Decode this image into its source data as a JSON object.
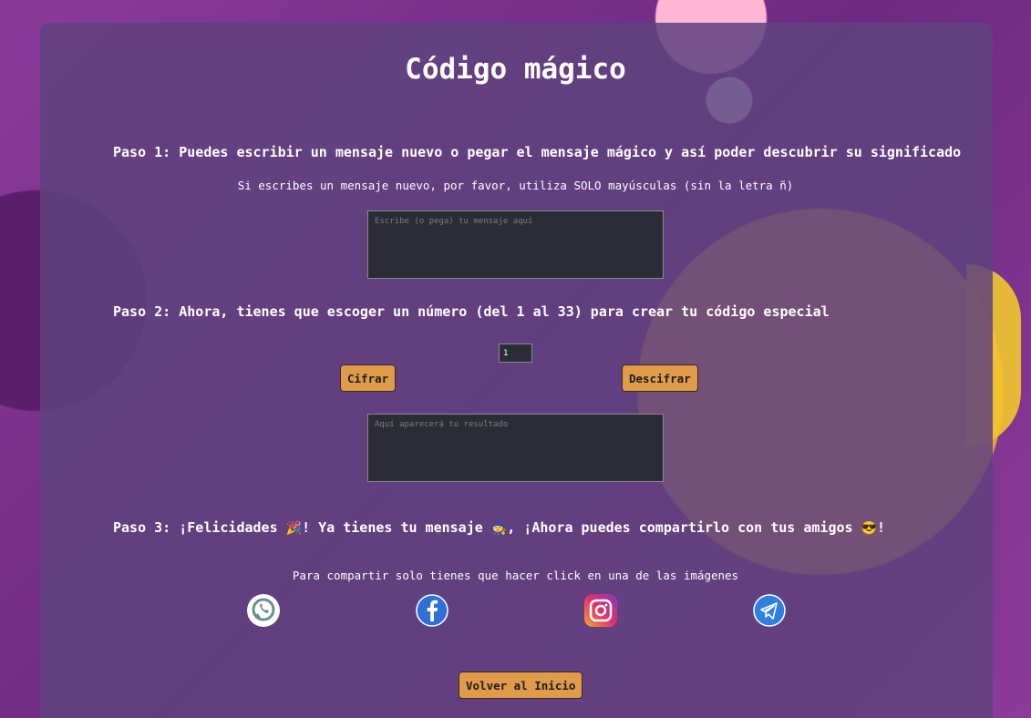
{
  "page": {
    "title": "Código mágico"
  },
  "step1": {
    "heading": "Paso 1: Puedes escribir un mensaje nuevo o pegar el mensaje mágico y así poder descubrir su significado",
    "note": "Si escribes un mensaje nuevo, por favor, utiliza SOLO mayúsculas (sin la letra ñ)",
    "input_placeholder": "Escribe (o pega) tu mensaje aquí",
    "input_value": ""
  },
  "step2": {
    "heading": "Paso 2: Ahora, tienes que escoger un número (del 1 al 33) para crear tu código especial",
    "number_value": "1",
    "encrypt_label": "Cifrar",
    "decrypt_label": "Descifrar",
    "result_placeholder": "Aquí aparecerá tu resultado",
    "result_value": ""
  },
  "step3": {
    "heading_part1": "Paso 3: ¡Felicidades ",
    "emoji_party": "🎉",
    "heading_part2": "! Ya tienes tu mensaje ",
    "emoji_wizard": "🧙",
    "heading_part3": ", ¡Ahora puedes compartirlo con tus amigos ",
    "emoji_cool": "😎",
    "heading_part4": "!",
    "share_note": "Para compartir solo tienes que hacer click en una de las imágenes"
  },
  "share_icons": [
    {
      "name": "whatsapp-icon",
      "color": "#6b8f8c"
    },
    {
      "name": "facebook-icon",
      "color": "#2f6fd6"
    },
    {
      "name": "instagram-icon",
      "color": "#c13584"
    },
    {
      "name": "telegram-icon",
      "color": "#2f7fe0"
    }
  ],
  "footer": {
    "back_label": "Volver al Inicio"
  }
}
